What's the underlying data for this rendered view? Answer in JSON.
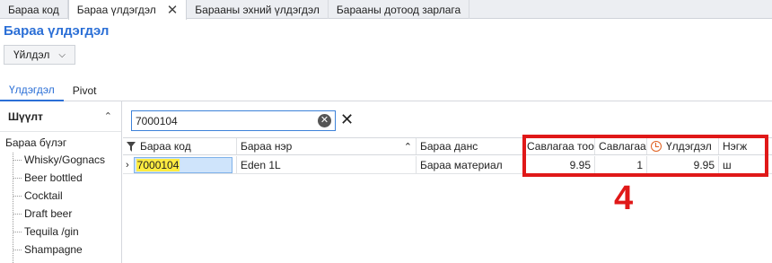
{
  "doc_tabs": [
    "Бараа код",
    "Бараа үлдэгдэл",
    "Барааны эхний үлдэгдэл",
    "Барааны дотоод зарлага"
  ],
  "page_title": "Бараа үлдэгдэл",
  "toolbar": {
    "dropdown_label": "Үйлдэл"
  },
  "view_tabs": [
    "Үлдэгдэл",
    "Pivot"
  ],
  "filter_panel": {
    "title": "Шүүлт",
    "root": "Бараа бүлэг",
    "items": [
      "Whisky/Gognacs",
      "Beer bottled",
      "Cocktail",
      "Draft beer",
      "Tequila /gin",
      "Shampagne"
    ]
  },
  "search": {
    "value": "7000104"
  },
  "grid": {
    "columns": [
      "Бараа код",
      "Бараа нэр",
      "Бараа данс",
      "Савлагаа тоо",
      "Савлагаа",
      "Үлдэгдэл",
      "Нэгж"
    ],
    "rows": [
      {
        "code": "7000104",
        "name": "Eden 1L",
        "account": "Бараа материал",
        "pack_qty": "9.95",
        "pack": "1",
        "balance": "9.95",
        "unit": "ш"
      }
    ]
  },
  "annotation": {
    "number": "4",
    "color": "#e01818"
  },
  "colors": {
    "accent": "#2b6fd6",
    "highlight": "#ffec40"
  }
}
